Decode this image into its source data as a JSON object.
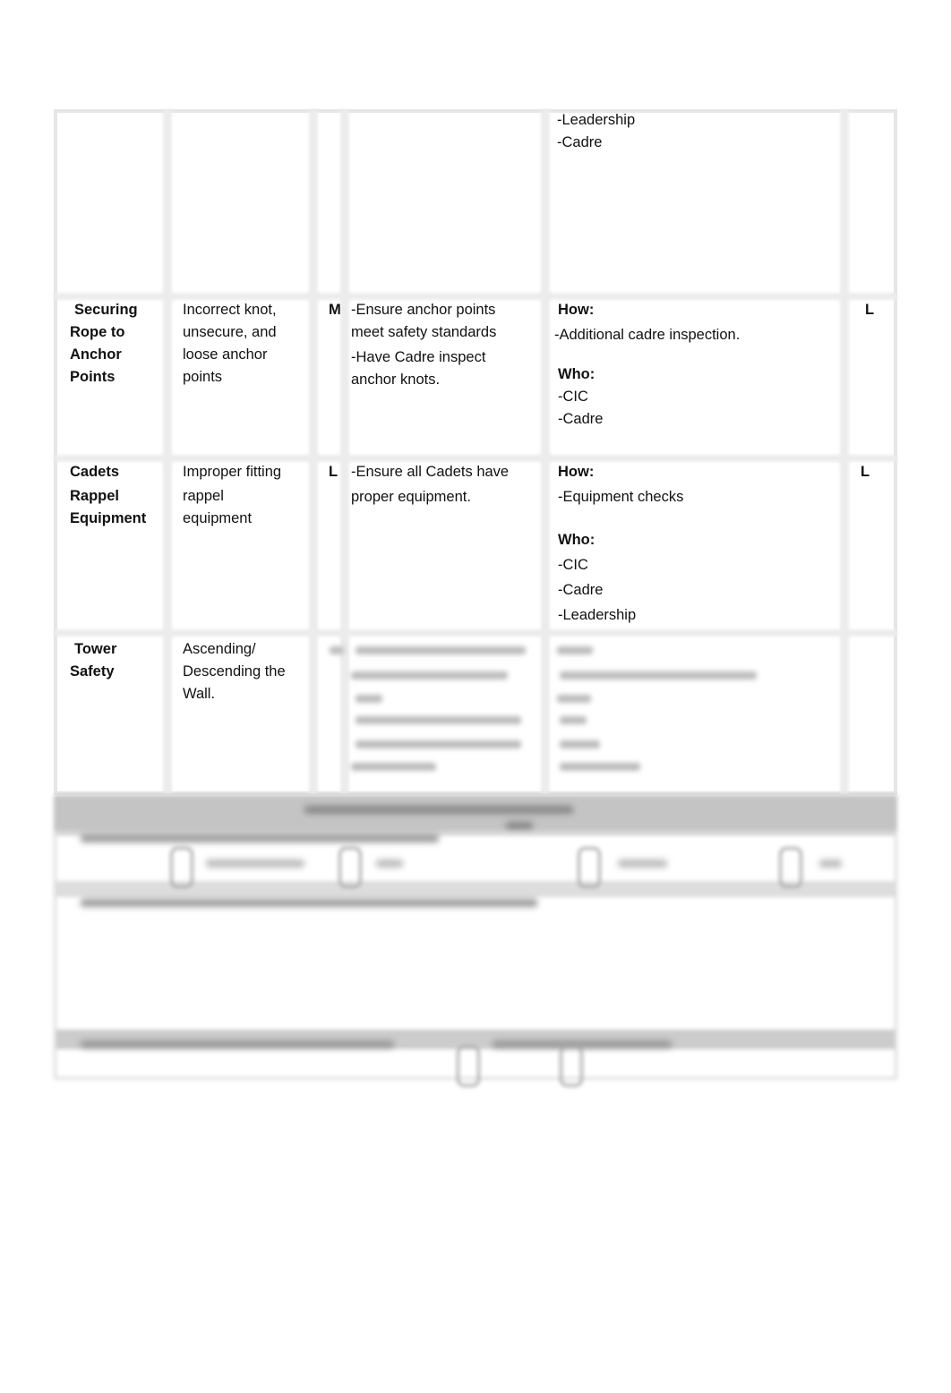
{
  "rows": [
    {
      "hazard": [],
      "cause": [],
      "initial_risk": "",
      "controls": [],
      "how_label": "",
      "how": [],
      "who_label": "",
      "who": [
        "-Leadership",
        "-Cadre"
      ],
      "residual_risk": ""
    },
    {
      "hazard": [
        "Securing",
        "Rope to",
        "Anchor",
        "Points"
      ],
      "cause": [
        "Incorrect knot,",
        "unsecure, and",
        "loose anchor",
        "points"
      ],
      "initial_risk": "M",
      "controls": [
        "-Ensure anchor points",
        "meet safety standards",
        "-Have Cadre inspect",
        "anchor knots."
      ],
      "how_label": "How:",
      "how": [
        "-Additional cadre inspection."
      ],
      "who_label": "Who:",
      "who": [
        "-CIC",
        "-Cadre"
      ],
      "residual_risk": "L"
    },
    {
      "hazard": [
        "Cadets",
        "Rappel",
        "Equipment"
      ],
      "cause": [
        "Improper fitting",
        "rappel",
        "equipment"
      ],
      "initial_risk": "L",
      "controls": [
        "-Ensure all Cadets have",
        "proper equipment."
      ],
      "how_label": "How:",
      "how": [
        "-Equipment checks"
      ],
      "who_label": "Who:",
      "who": [
        "-CIC",
        "-Cadre",
        "-Leadership"
      ],
      "residual_risk": "L"
    },
    {
      "hazard": [
        "Tower",
        "Safety"
      ],
      "cause": [
        "Ascending/",
        "Descending the",
        "Wall."
      ],
      "initial_risk": "",
      "controls": [],
      "how_label": "",
      "how": [],
      "who_label": "",
      "who": [],
      "residual_risk": ""
    }
  ]
}
